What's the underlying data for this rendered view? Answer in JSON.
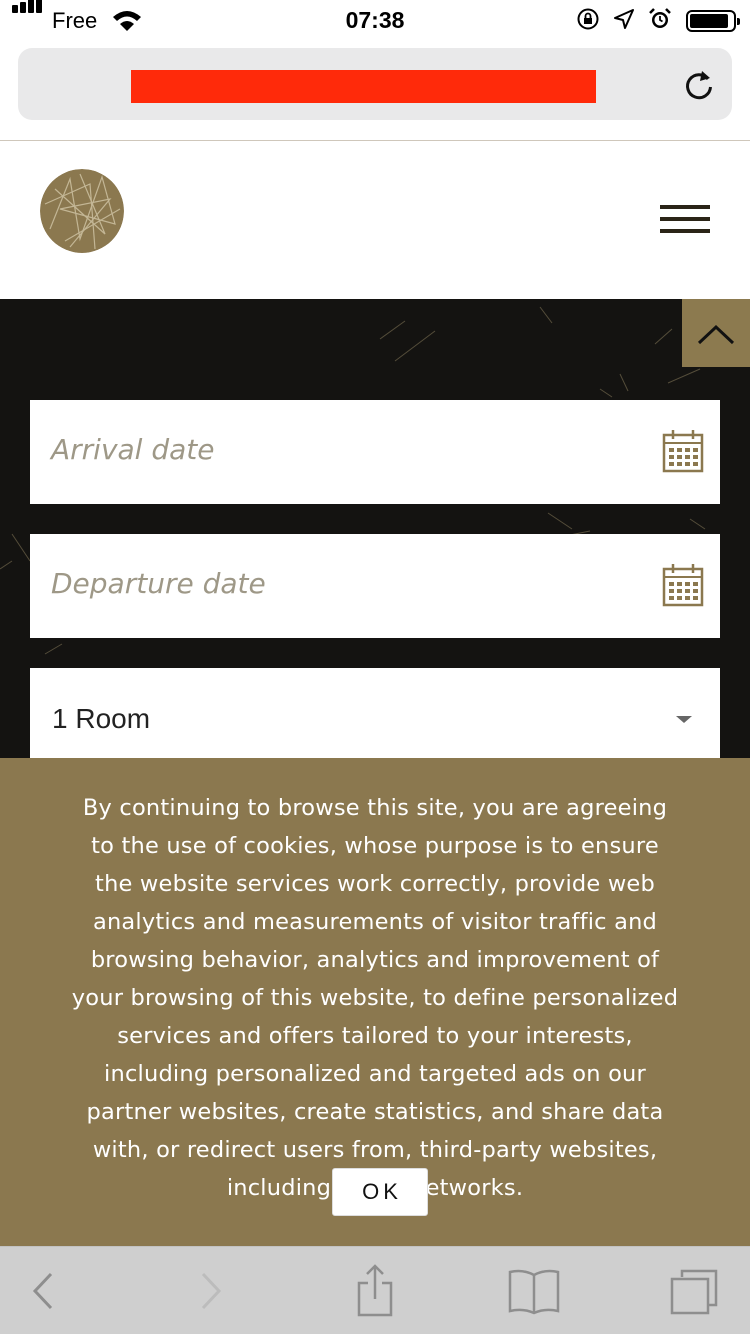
{
  "status_bar": {
    "carrier": "Free",
    "time": "07:38",
    "icons": [
      "signal-icon",
      "wifi-icon",
      "rotation-lock-icon",
      "location-arrow-icon",
      "alarm-icon",
      "battery-icon"
    ]
  },
  "browser": {
    "url_redacted": true,
    "redaction_color": "#ff2a0a",
    "icons": [
      "reload-icon"
    ]
  },
  "header": {
    "logo": "logo-emblem",
    "menu_icon": "hamburger-menu-icon"
  },
  "booking": {
    "arrival": {
      "placeholder": "Arrival date",
      "icon": "calendar-icon"
    },
    "departure": {
      "placeholder": "Departure date",
      "icon": "calendar-icon"
    },
    "rooms": {
      "selected": "1 Room",
      "icon": "caret-down-icon"
    },
    "scroll_top_icon": "chevron-up-icon"
  },
  "cookie_banner": {
    "text": "By continuing to browse this site, you are agreeing to the use of cookies, whose purpose is to ensure the website services work correctly, provide web analytics and measurements of visitor traffic and browsing behavior, analytics and improvement of your browsing of this website, to define personalized services and offers tailored to your interests, including personalized and targeted ads on our partner websites, create statistics, and share data with, or redirect users from, third-party websites, including social networks.",
    "ok_label": "OK"
  },
  "toolbar": {
    "icons": [
      "back-icon",
      "forward-icon",
      "share-icon",
      "bookmarks-icon",
      "tabs-icon"
    ]
  },
  "colors": {
    "brand_gold": "#8b784f",
    "dark_background": "#141311",
    "placeholder_text": "#9e9887"
  }
}
